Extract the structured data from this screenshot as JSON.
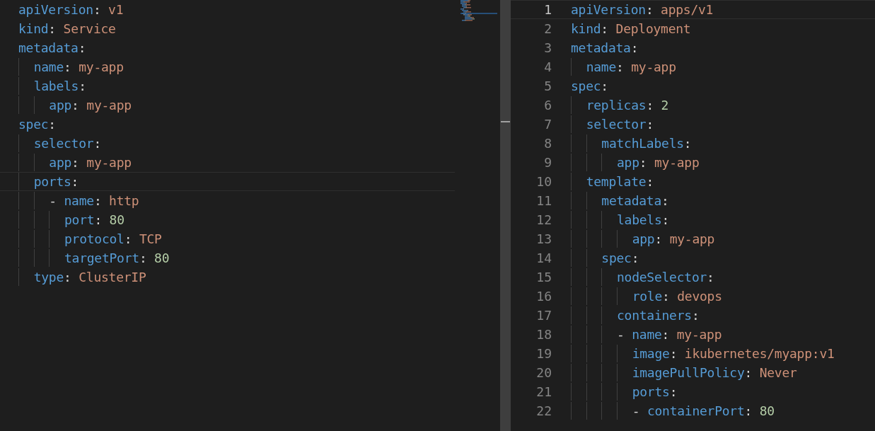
{
  "editors": [
    {
      "show_line_numbers": false,
      "lines": [
        {
          "current": false,
          "tokens": [
            {
              "kind": "key",
              "text": "apiVersion"
            },
            {
              "kind": "punct",
              "text": ": "
            },
            {
              "kind": "string",
              "text": "v1"
            }
          ]
        },
        {
          "current": false,
          "tokens": [
            {
              "kind": "key",
              "text": "kind"
            },
            {
              "kind": "punct",
              "text": ": "
            },
            {
              "kind": "string",
              "text": "Service"
            }
          ]
        },
        {
          "current": false,
          "tokens": [
            {
              "kind": "key",
              "text": "metadata"
            },
            {
              "kind": "punct",
              "text": ":"
            }
          ]
        },
        {
          "current": false,
          "tokens": [
            {
              "kind": "key",
              "text": "  name"
            },
            {
              "kind": "punct",
              "text": ": "
            },
            {
              "kind": "string",
              "text": "my-app"
            }
          ]
        },
        {
          "current": false,
          "tokens": [
            {
              "kind": "key",
              "text": "  labels"
            },
            {
              "kind": "punct",
              "text": ":"
            }
          ]
        },
        {
          "current": false,
          "tokens": [
            {
              "kind": "key",
              "text": "    app"
            },
            {
              "kind": "punct",
              "text": ": "
            },
            {
              "kind": "string",
              "text": "my-app"
            }
          ]
        },
        {
          "current": false,
          "tokens": [
            {
              "kind": "key",
              "text": "spec"
            },
            {
              "kind": "punct",
              "text": ":"
            }
          ]
        },
        {
          "current": false,
          "tokens": [
            {
              "kind": "key",
              "text": "  selector"
            },
            {
              "kind": "punct",
              "text": ":"
            }
          ]
        },
        {
          "current": false,
          "tokens": [
            {
              "kind": "key",
              "text": "    app"
            },
            {
              "kind": "punct",
              "text": ": "
            },
            {
              "kind": "string",
              "text": "my-app"
            }
          ]
        },
        {
          "current": true,
          "tokens": [
            {
              "kind": "key",
              "text": "  ports"
            },
            {
              "kind": "punct",
              "text": ":"
            }
          ]
        },
        {
          "current": false,
          "tokens": [
            {
              "kind": "punct",
              "text": "    - "
            },
            {
              "kind": "key",
              "text": "name"
            },
            {
              "kind": "punct",
              "text": ": "
            },
            {
              "kind": "string",
              "text": "http"
            }
          ]
        },
        {
          "current": false,
          "tokens": [
            {
              "kind": "key",
              "text": "      port"
            },
            {
              "kind": "punct",
              "text": ": "
            },
            {
              "kind": "number",
              "text": "80"
            }
          ]
        },
        {
          "current": false,
          "tokens": [
            {
              "kind": "key",
              "text": "      protocol"
            },
            {
              "kind": "punct",
              "text": ": "
            },
            {
              "kind": "string",
              "text": "TCP"
            }
          ]
        },
        {
          "current": false,
          "tokens": [
            {
              "kind": "key",
              "text": "      targetPort"
            },
            {
              "kind": "punct",
              "text": ": "
            },
            {
              "kind": "number",
              "text": "80"
            }
          ]
        },
        {
          "current": false,
          "tokens": [
            {
              "kind": "key",
              "text": "  type"
            },
            {
              "kind": "punct",
              "text": ": "
            },
            {
              "kind": "string",
              "text": "ClusterIP"
            }
          ]
        }
      ]
    },
    {
      "show_line_numbers": true,
      "lines": [
        {
          "number": "1",
          "current": true,
          "tokens": [
            {
              "kind": "key",
              "text": "apiVersion"
            },
            {
              "kind": "punct",
              "text": ": "
            },
            {
              "kind": "string",
              "text": "apps/v1"
            }
          ]
        },
        {
          "number": "2",
          "current": false,
          "tokens": [
            {
              "kind": "key",
              "text": "kind"
            },
            {
              "kind": "punct",
              "text": ": "
            },
            {
              "kind": "string",
              "text": "Deployment"
            }
          ]
        },
        {
          "number": "3",
          "current": false,
          "tokens": [
            {
              "kind": "key",
              "text": "metadata"
            },
            {
              "kind": "punct",
              "text": ":"
            }
          ]
        },
        {
          "number": "4",
          "current": false,
          "tokens": [
            {
              "kind": "key",
              "text": "  name"
            },
            {
              "kind": "punct",
              "text": ": "
            },
            {
              "kind": "string",
              "text": "my-app"
            }
          ]
        },
        {
          "number": "5",
          "current": false,
          "tokens": [
            {
              "kind": "key",
              "text": "spec"
            },
            {
              "kind": "punct",
              "text": ":"
            }
          ]
        },
        {
          "number": "6",
          "current": false,
          "tokens": [
            {
              "kind": "key",
              "text": "  replicas"
            },
            {
              "kind": "punct",
              "text": ": "
            },
            {
              "kind": "number",
              "text": "2"
            }
          ]
        },
        {
          "number": "7",
          "current": false,
          "tokens": [
            {
              "kind": "key",
              "text": "  selector"
            },
            {
              "kind": "punct",
              "text": ":"
            }
          ]
        },
        {
          "number": "8",
          "current": false,
          "tokens": [
            {
              "kind": "key",
              "text": "    matchLabels"
            },
            {
              "kind": "punct",
              "text": ":"
            }
          ]
        },
        {
          "number": "9",
          "current": false,
          "tokens": [
            {
              "kind": "key",
              "text": "      app"
            },
            {
              "kind": "punct",
              "text": ": "
            },
            {
              "kind": "string",
              "text": "my-app"
            }
          ]
        },
        {
          "number": "10",
          "current": false,
          "tokens": [
            {
              "kind": "key",
              "text": "  template"
            },
            {
              "kind": "punct",
              "text": ":"
            }
          ]
        },
        {
          "number": "11",
          "current": false,
          "tokens": [
            {
              "kind": "key",
              "text": "    metadata"
            },
            {
              "kind": "punct",
              "text": ":"
            }
          ]
        },
        {
          "number": "12",
          "current": false,
          "tokens": [
            {
              "kind": "key",
              "text": "      labels"
            },
            {
              "kind": "punct",
              "text": ":"
            }
          ]
        },
        {
          "number": "13",
          "current": false,
          "tokens": [
            {
              "kind": "key",
              "text": "        app"
            },
            {
              "kind": "punct",
              "text": ": "
            },
            {
              "kind": "string",
              "text": "my-app"
            }
          ]
        },
        {
          "number": "14",
          "current": false,
          "tokens": [
            {
              "kind": "key",
              "text": "    spec"
            },
            {
              "kind": "punct",
              "text": ":"
            }
          ]
        },
        {
          "number": "15",
          "current": false,
          "tokens": [
            {
              "kind": "key",
              "text": "      nodeSelector"
            },
            {
              "kind": "punct",
              "text": ":"
            }
          ]
        },
        {
          "number": "16",
          "current": false,
          "tokens": [
            {
              "kind": "key",
              "text": "        role"
            },
            {
              "kind": "punct",
              "text": ": "
            },
            {
              "kind": "string",
              "text": "devops"
            }
          ]
        },
        {
          "number": "17",
          "current": false,
          "tokens": [
            {
              "kind": "key",
              "text": "      containers"
            },
            {
              "kind": "punct",
              "text": ":"
            }
          ]
        },
        {
          "number": "18",
          "current": false,
          "tokens": [
            {
              "kind": "punct",
              "text": "      - "
            },
            {
              "kind": "key",
              "text": "name"
            },
            {
              "kind": "punct",
              "text": ": "
            },
            {
              "kind": "string",
              "text": "my-app"
            }
          ]
        },
        {
          "number": "19",
          "current": false,
          "tokens": [
            {
              "kind": "key",
              "text": "        image"
            },
            {
              "kind": "punct",
              "text": ": "
            },
            {
              "kind": "string",
              "text": "ikubernetes/myapp:v1"
            }
          ]
        },
        {
          "number": "20",
          "current": false,
          "tokens": [
            {
              "kind": "key",
              "text": "        imagePullPolicy"
            },
            {
              "kind": "punct",
              "text": ": "
            },
            {
              "kind": "string",
              "text": "Never"
            }
          ]
        },
        {
          "number": "21",
          "current": false,
          "tokens": [
            {
              "kind": "key",
              "text": "        ports"
            },
            {
              "kind": "punct",
              "text": ":"
            }
          ]
        },
        {
          "number": "22",
          "current": false,
          "tokens": [
            {
              "kind": "punct",
              "text": "        - "
            },
            {
              "kind": "key",
              "text": "containerPort"
            },
            {
              "kind": "punct",
              "text": ": "
            },
            {
              "kind": "number",
              "text": "80"
            }
          ]
        }
      ]
    }
  ]
}
